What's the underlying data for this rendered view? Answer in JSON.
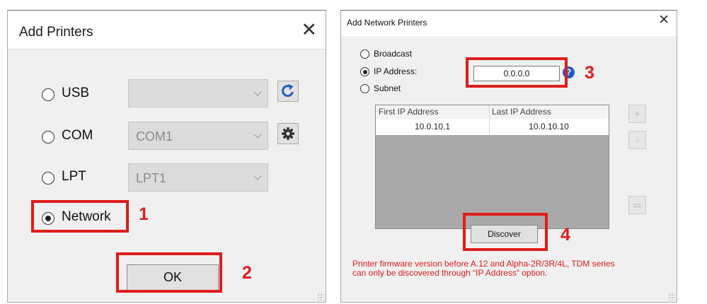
{
  "add_printers": {
    "title": "Add Printers",
    "close_glyph": "✕",
    "rows": [
      {
        "label": "USB",
        "selected": false,
        "combo_value": "",
        "icon": "refresh-icon"
      },
      {
        "label": "COM",
        "selected": false,
        "combo_value": "COM1",
        "icon": "gear-icon"
      },
      {
        "label": "LPT",
        "selected": false,
        "combo_value": "LPT1"
      },
      {
        "label": "Network",
        "selected": true
      }
    ],
    "ok_label": "OK"
  },
  "add_network_printers": {
    "title": "Add Network Printers",
    "close_glyph": "✕",
    "options": [
      {
        "label": "Broadcast",
        "selected": false
      },
      {
        "label": "IP Address:",
        "selected": true
      },
      {
        "label": "Subnet",
        "selected": false
      }
    ],
    "ip_value": "0.0.0.0",
    "help_glyph": "?",
    "table": {
      "columns": [
        "First IP Address",
        "Last IP Address"
      ],
      "rows": [
        [
          "10.0.10.1",
          "10.0.10.10"
        ]
      ]
    },
    "side_buttons": {
      "add": "+",
      "remove": "-",
      "folder": "▭"
    },
    "discover_label": "Discover",
    "note_line1": "Printer firmware version before A.12 and Alpha-2R/3R/4L, TDM series",
    "note_line2": "can only be discovered through “IP Address” option."
  },
  "annotations": [
    "1",
    "2",
    "3",
    "4"
  ],
  "colors": {
    "highlight": "#e01c1c",
    "help_blue": "#1e5fbf"
  }
}
